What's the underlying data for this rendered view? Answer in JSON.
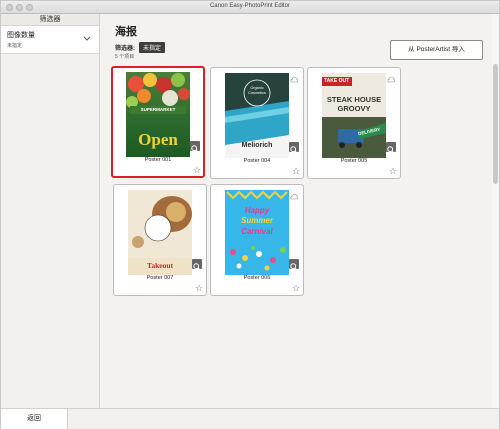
{
  "window": {
    "title": "Canon Easy-PhotoPrint Editor"
  },
  "sidebar": {
    "header": "筛选器",
    "filter": {
      "label": "图像数量",
      "value": "未指定"
    }
  },
  "main": {
    "title": "海报",
    "filter_label": "筛选器:",
    "filter_chip": "未指定",
    "count": "5 个项目",
    "import_button": "从 PosterArtist 导入"
  },
  "posters": [
    {
      "name": "Poster 001",
      "selected": true,
      "top_text": "SUPERMARKET",
      "big_text": "Open"
    },
    {
      "name": "Poster 004",
      "selected": false,
      "top_text": "Organic Cosmetics",
      "big_text": "Meliorich"
    },
    {
      "name": "Poster 005",
      "selected": false,
      "tag1": "TAKE OUT",
      "title1": "STEAK HOUSE",
      "title2": "GROOVY",
      "tag2": "DELIVERY"
    },
    {
      "name": "Poster 007",
      "selected": false,
      "big_text": "Takeout"
    },
    {
      "name": "Poster 006",
      "selected": false,
      "line1": "Happy",
      "line2": "Summer",
      "line3": "Carnival"
    }
  ],
  "footer": {
    "back_button": "返回"
  },
  "colors": {
    "selected_border": "#d6202a",
    "chip_bg": "#3e3e3e"
  },
  "icons": {
    "zoom": "magnifier-icon",
    "favorite": "star-outline-icon",
    "cloud": "cloud-icon",
    "dropdown": "chevron-down-icon"
  }
}
